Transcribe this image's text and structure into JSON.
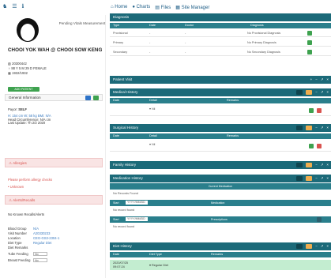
{
  "topbar": {
    "icons": [
      "person-icon",
      "menu-icon",
      "info-icon"
    ]
  },
  "nav": {
    "items": [
      {
        "icon": "home-icon",
        "label": "Home"
      },
      {
        "icon": "chart-icon",
        "label": "Charts"
      },
      {
        "icon": "files-icon",
        "label": "Files"
      },
      {
        "icon": "site-manager-icon",
        "label": "Site Manager"
      }
    ]
  },
  "patient": {
    "pending": "Pending Vitals Measurement",
    "name": "CHOOI YOK WAH @ CHOOI SOW KENG",
    "id": "20300442",
    "age_gender": "88 Y 5 M 29 D FEMALE",
    "dob": "1932/1932",
    "add_btn": "ADD PATIENT",
    "general_info": "General Information",
    "payor_label": "Payor:",
    "payor": "SELF",
    "vitals_line1": "H: 154 cm  W: 58 kg  BMI: N/A",
    "vitals_line2": "Head Circumference: N/A cm",
    "vitals_line3": "Last Update: Th 2/2 2020",
    "allergies_title": "Allergies",
    "allergy_msg": "Please perform allergy checks",
    "allergy_item": "Unknown",
    "alerts_title": "Alerts/Recalls",
    "no_alerts": "No Known Recalls/Alerts",
    "details": [
      {
        "k": "Blood Group",
        "v": "N/A"
      },
      {
        "k": "Visit Number",
        "v": "A20330233"
      },
      {
        "k": "Location",
        "v": "CEG-GS3-2304-1"
      },
      {
        "k": "Diet Type",
        "v": "Regular Diet"
      },
      {
        "k": "Diet Remarks",
        "v": ""
      }
    ],
    "tube_feeding": {
      "label": "Tube Feeding",
      "value": "No"
    },
    "breast_feeding": {
      "label": "Breast Feeding",
      "value": "No"
    }
  },
  "diagnosis": {
    "title": "Diagnosis",
    "headers": [
      "Type",
      "Date",
      "Doctor",
      "Diagnosis"
    ],
    "rows": [
      {
        "type": "Provisional",
        "date": "-",
        "doctor": "-",
        "dx": "No Provisional Diagnosis"
      },
      {
        "type": "Primary",
        "date": "-",
        "doctor": "-",
        "dx": "No Primary Diagnosis"
      },
      {
        "type": "Secondary",
        "date": "-",
        "doctor": "-",
        "dx": "No Secondary Diagnosis"
      }
    ]
  },
  "patient_visit": {
    "title": "Patient Visit"
  },
  "medical_history": {
    "title": "Medical History",
    "headers": [
      "Date",
      "Detail",
      "Remarks"
    ],
    "row_detail": "Nil"
  },
  "surgical_history": {
    "title": "Surgical History",
    "headers": [
      "Date",
      "Detail",
      "Remarks"
    ],
    "row_detail": "Nil"
  },
  "family_history": {
    "title": "Family History"
  },
  "medication_history": {
    "title": "Medication History",
    "current": "Current Medication",
    "no_records": "No Records Found",
    "medication_label": "Medication",
    "prescriptions_label": "Prescriptions",
    "start_label": "Start",
    "start_date": "YYYY/MM/DD",
    "no_record": "No record found"
  },
  "diet_history": {
    "title": "Diet History",
    "headers": [
      "Date",
      "Diet Type",
      "Remarks"
    ],
    "row": {
      "date": "2020/07/25 09:07:24",
      "type": "Regular Diet",
      "remarks": ""
    }
  },
  "colors": {
    "header": "#1c6a79",
    "table_header": "#2a7f8c",
    "green": "#3ea24f",
    "red": "#d9534f",
    "yellow": "#f0ad4e",
    "blue": "#2d73c8"
  }
}
